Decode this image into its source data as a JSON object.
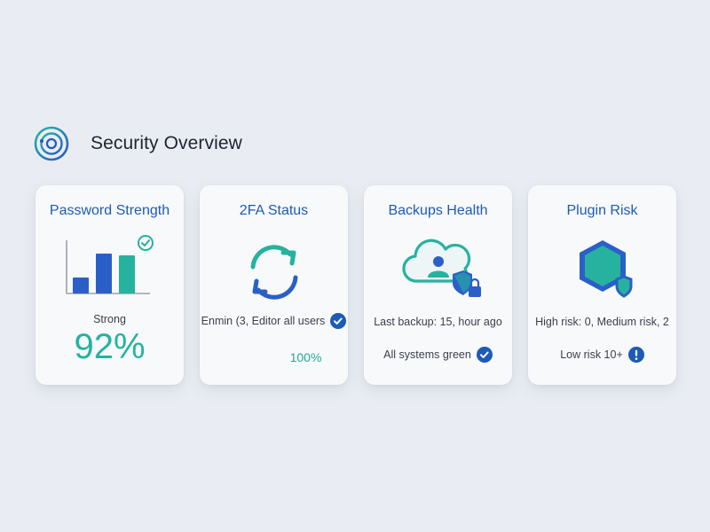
{
  "header": {
    "title": "Security Overview",
    "logo_icon": "radar-target-icon"
  },
  "colors": {
    "accent_blue": "#1d5bb5",
    "accent_teal": "#24b3a0",
    "background": "#e9edf3"
  },
  "cards": [
    {
      "title": "Password Strength",
      "icon": "bar-chart-check-icon",
      "bars": [
        0.3,
        0.75,
        0.72
      ],
      "label": "Strong",
      "value": "92%"
    },
    {
      "title": "2FA Status",
      "icon": "sync-arrows-icon",
      "status_line": "Enmin (3, Editor all users",
      "status_icon": "check-circle-icon",
      "value": "100%"
    },
    {
      "title": "Backups Health",
      "icon": "cloud-user-shield-lock-icon",
      "detail": "Last backup: 15, hour ago",
      "status_line": "All systems green",
      "status_icon": "check-circle-icon"
    },
    {
      "title": "Plugin Risk",
      "icon": "hexagon-shield-icon",
      "detail": "High risk: 0, Medium risk, 2",
      "status_line": "Low risk 10+",
      "status_icon": "exclamation-circle-icon"
    }
  ]
}
